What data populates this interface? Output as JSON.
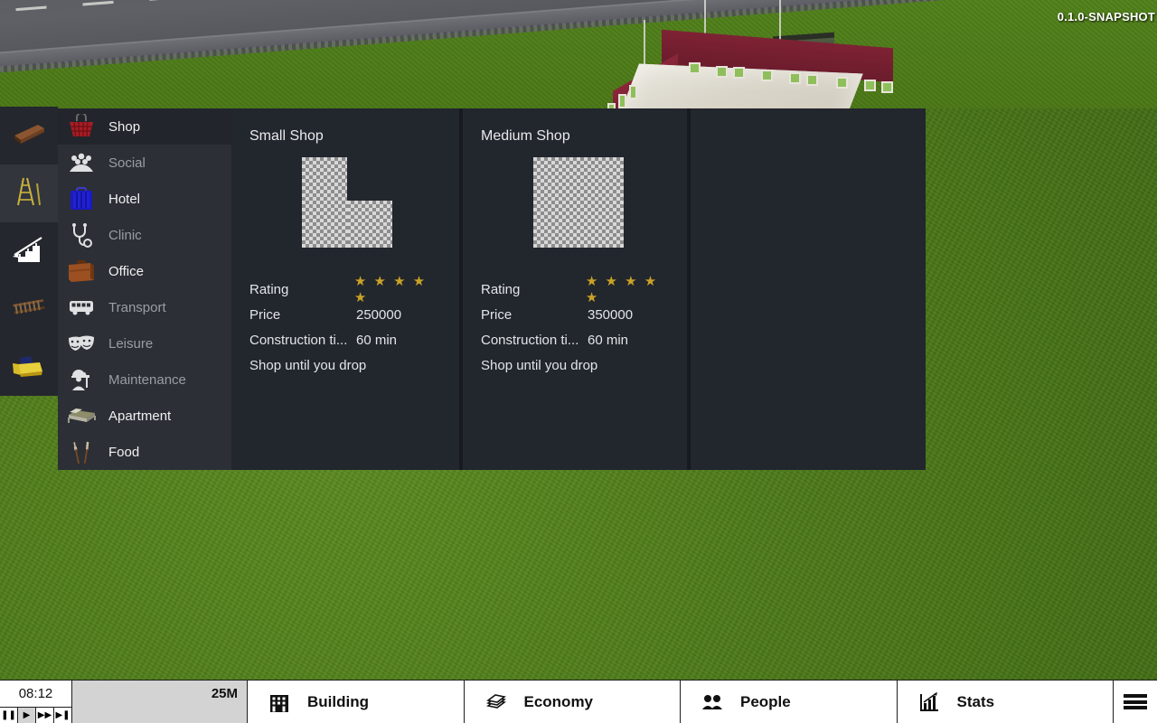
{
  "version_label": "0.1.0-SNAPSHOT",
  "colors": {
    "panel_bg": "#22262d",
    "menu_bg": "#2c2f36",
    "selected_bg": "#22252b",
    "star_gold": "#c9a227",
    "money_bg": "#d3d3d3",
    "grass": "#4d7a18"
  },
  "tool_rail": {
    "items": [
      {
        "name": "beam-tool",
        "icon": "steel-beam-icon",
        "selected": false
      },
      {
        "name": "ladder-tool",
        "icon": "ladder-icon",
        "selected": false
      },
      {
        "name": "stairs-tool",
        "icon": "stairs-icon",
        "selected": true
      },
      {
        "name": "track-tool",
        "icon": "railroad-track-icon",
        "selected": false
      },
      {
        "name": "bulldozer-tool",
        "icon": "bulldozer-icon",
        "selected": false
      }
    ]
  },
  "category_menu": {
    "items": [
      {
        "label": "Shop",
        "icon": "shopping-basket-icon",
        "enabled": true,
        "selected": true
      },
      {
        "label": "Social",
        "icon": "crowd-icon",
        "enabled": false,
        "selected": false
      },
      {
        "label": "Hotel",
        "icon": "suitcase-icon",
        "enabled": true,
        "selected": false
      },
      {
        "label": "Clinic",
        "icon": "stethoscope-icon",
        "enabled": false,
        "selected": false
      },
      {
        "label": "Office",
        "icon": "briefcase-icon",
        "enabled": true,
        "selected": false
      },
      {
        "label": "Transport",
        "icon": "bus-icon",
        "enabled": false,
        "selected": false
      },
      {
        "label": "Leisure",
        "icon": "theater-masks-icon",
        "enabled": false,
        "selected": false
      },
      {
        "label": "Maintenance",
        "icon": "worker-icon",
        "enabled": false,
        "selected": false
      },
      {
        "label": "Apartment",
        "icon": "bed-icon",
        "enabled": true,
        "selected": false
      },
      {
        "label": "Food",
        "icon": "cutlery-icon",
        "enabled": true,
        "selected": false
      }
    ]
  },
  "cards": {
    "labels": {
      "rating": "Rating",
      "price": "Price",
      "construction_time": "Construction ti..."
    },
    "items": [
      {
        "title": "Small Shop",
        "thumb_shape": "L",
        "rating_stars": "★ ★ ★ ★ ★",
        "rating_value": 5,
        "price": "250000",
        "construction_time": "60 min",
        "description": "Shop until you drop"
      },
      {
        "title": "Medium Shop",
        "thumb_shape": "square",
        "rating_stars": "★ ★ ★ ★ ★",
        "rating_value": 5,
        "price": "350000",
        "construction_time": "60 min",
        "description": "Shop until you drop"
      }
    ]
  },
  "bottom_bar": {
    "time": "08:12",
    "money": "25M",
    "speed_controls": [
      {
        "name": "pause-button",
        "glyph": "❚❚",
        "active": false
      },
      {
        "name": "play-button",
        "glyph": "▶",
        "active": true
      },
      {
        "name": "fast-forward-button",
        "glyph": "▶▶",
        "active": false
      },
      {
        "name": "skip-button",
        "glyph": "▶❚",
        "active": false
      }
    ],
    "tabs": [
      {
        "label": "Building",
        "icon": "building-icon"
      },
      {
        "label": "Economy",
        "icon": "money-stack-icon"
      },
      {
        "label": "People",
        "icon": "people-icon"
      },
      {
        "label": "Stats",
        "icon": "bar-chart-icon"
      }
    ],
    "menu_button": "hamburger-menu-icon"
  }
}
